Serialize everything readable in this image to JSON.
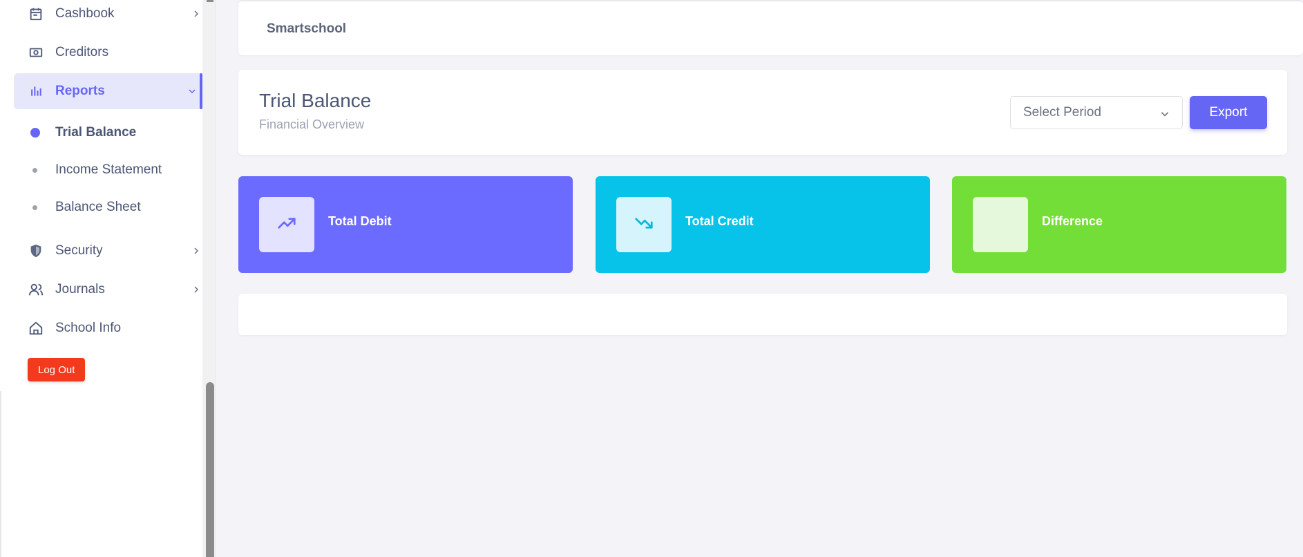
{
  "sidebar": {
    "items": [
      {
        "label": "Cashbook",
        "icon": "calendar-icon"
      },
      {
        "label": "Creditors",
        "icon": "money-icon"
      },
      {
        "label": "Reports",
        "icon": "bar-chart-icon"
      },
      {
        "label": "Security",
        "icon": "shield-icon"
      },
      {
        "label": "Journals",
        "icon": "users-icon"
      },
      {
        "label": "School Info",
        "icon": "home-icon"
      }
    ],
    "subitems": [
      {
        "label": "Trial Balance"
      },
      {
        "label": "Income Statement"
      },
      {
        "label": "Balance Sheet"
      }
    ],
    "logout_label": "Log Out"
  },
  "topbar": {
    "brand": "Smartschool"
  },
  "header": {
    "title": "Trial Balance",
    "subtitle": "Financial Overview",
    "select_value": "Select Period",
    "export_label": "Export"
  },
  "stats": [
    {
      "label": "Total Debit",
      "color": "#6b6bff",
      "icon": "trending-up-icon"
    },
    {
      "label": "Total Credit",
      "color": "#07c3ea",
      "icon": "trending-down-icon"
    },
    {
      "label": "Difference",
      "color": "#72de37",
      "icon": ""
    }
  ],
  "colors": {
    "accent": "#6666f5",
    "logout": "#f33a1c"
  }
}
